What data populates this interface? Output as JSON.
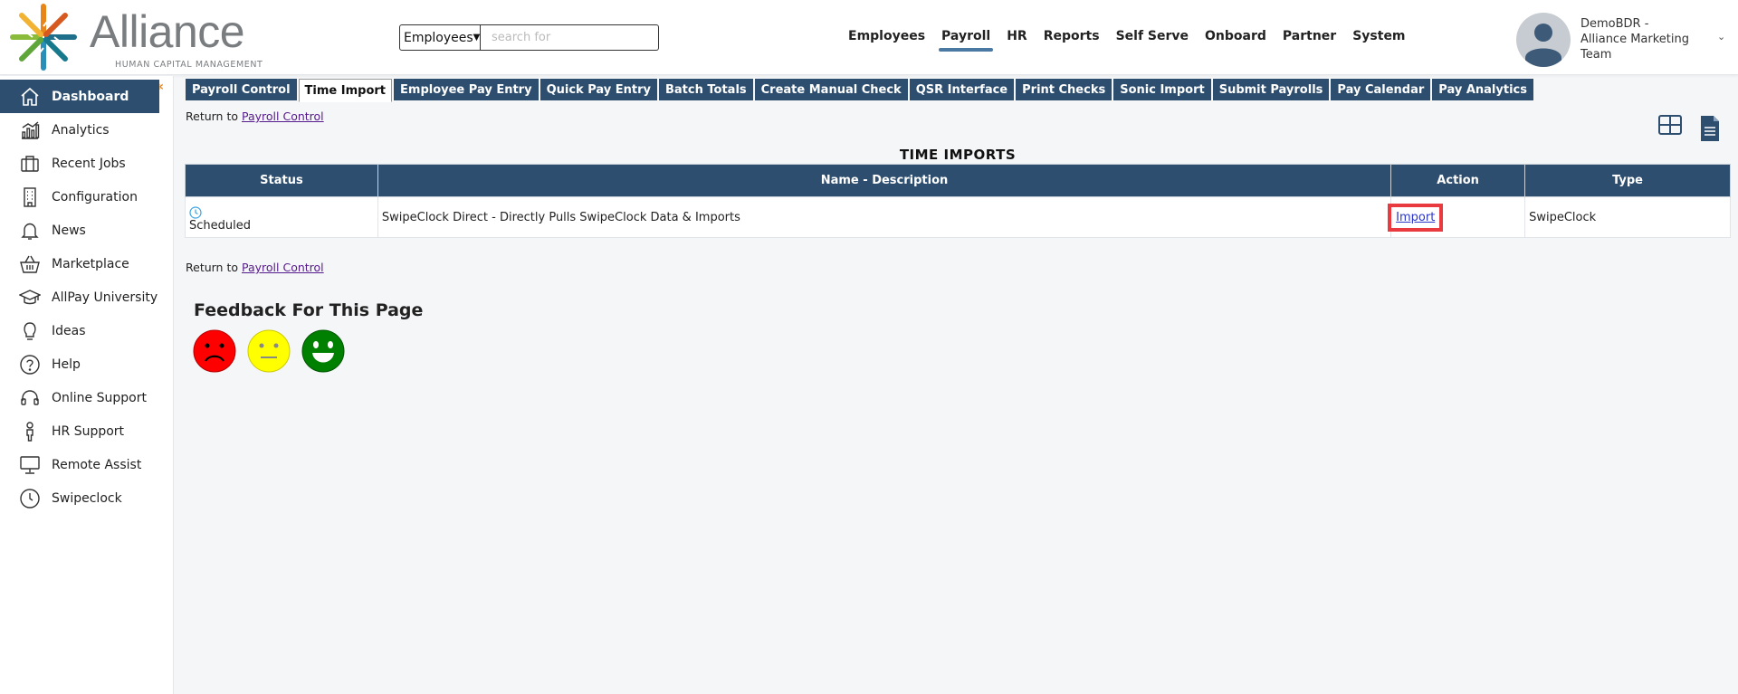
{
  "brand": {
    "name": "Alliance",
    "tagline": "HUMAN CAPITAL MANAGEMENT"
  },
  "search": {
    "scope": "Employees",
    "placeholder": "search for"
  },
  "topnav": [
    {
      "label": "Employees",
      "active": false
    },
    {
      "label": "Payroll",
      "active": true
    },
    {
      "label": "HR",
      "active": false
    },
    {
      "label": "Reports",
      "active": false
    },
    {
      "label": "Self Serve",
      "active": false
    },
    {
      "label": "Onboard",
      "active": false
    },
    {
      "label": "Partner",
      "active": false
    },
    {
      "label": "System",
      "active": false
    }
  ],
  "user": {
    "name": "DemoBDR - Alliance Marketing Team"
  },
  "sidebar": {
    "items": [
      {
        "label": "Dashboard",
        "icon": "home-icon",
        "active": true
      },
      {
        "label": "Analytics",
        "icon": "analytics-icon"
      },
      {
        "label": "Recent Jobs",
        "icon": "briefcase-icon"
      },
      {
        "label": "Configuration",
        "icon": "building-icon"
      },
      {
        "label": "News",
        "icon": "bell-icon"
      },
      {
        "label": "Marketplace",
        "icon": "basket-icon"
      },
      {
        "label": "AllPay University",
        "icon": "graduation-cap-icon"
      },
      {
        "label": "Ideas",
        "icon": "lightbulb-icon"
      },
      {
        "label": "Help",
        "icon": "question-icon"
      },
      {
        "label": "Online Support",
        "icon": "headset-icon"
      },
      {
        "label": "HR Support",
        "icon": "person-icon"
      },
      {
        "label": "Remote Assist",
        "icon": "monitor-icon"
      },
      {
        "label": "Swipeclock",
        "icon": "clock-icon"
      }
    ]
  },
  "tabs": [
    {
      "label": "Payroll Control",
      "active": false
    },
    {
      "label": "Time Import",
      "active": true
    },
    {
      "label": "Employee Pay Entry",
      "active": false
    },
    {
      "label": "Quick Pay Entry",
      "active": false
    },
    {
      "label": "Batch Totals",
      "active": false
    },
    {
      "label": "Create Manual Check",
      "active": false
    },
    {
      "label": "QSR Interface",
      "active": false
    },
    {
      "label": "Print Checks",
      "active": false
    },
    {
      "label": "Sonic Import",
      "active": false
    },
    {
      "label": "Submit Payrolls",
      "active": false
    },
    {
      "label": "Pay Calendar",
      "active": false
    },
    {
      "label": "Pay Analytics",
      "active": false
    }
  ],
  "return_link": {
    "prefix": "Return to",
    "link": "Payroll Control"
  },
  "section": {
    "title": "TIME IMPORTS"
  },
  "table": {
    "columns": [
      "Status",
      "Name - Description",
      "Action",
      "Type"
    ],
    "rows": [
      {
        "status": "Scheduled",
        "name": "SwipeClock Direct - Directly Pulls SwipeClock Data & Imports",
        "action": "Import",
        "type": "SwipeClock"
      }
    ]
  },
  "feedback": {
    "title": "Feedback For This Page"
  },
  "colors": {
    "navy": "#2d4e6e",
    "highlight": "#e83a3f",
    "sad": "#ff0000",
    "neutral": "#ffff00",
    "happy": "#008000"
  }
}
